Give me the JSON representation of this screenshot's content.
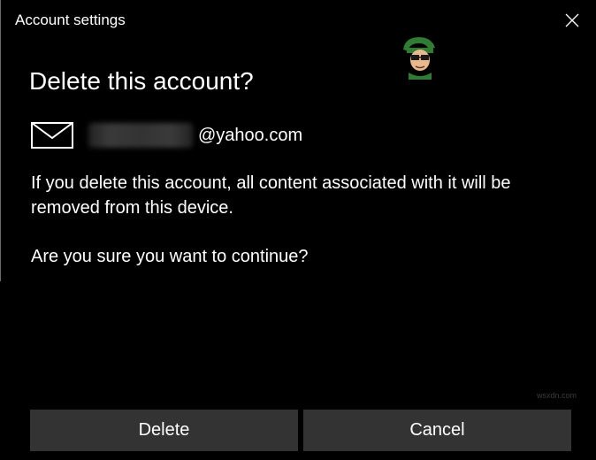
{
  "window": {
    "title": "Account settings",
    "close_icon": "close-icon"
  },
  "dialog": {
    "heading": "Delete this account?",
    "account": {
      "icon": "mail-icon",
      "email_suffix": "@yahoo.com"
    },
    "message": "If you delete this account, all content associated with it will be removed from this device.",
    "question": "Are you sure you want to continue?"
  },
  "buttons": {
    "delete_label": "Delete",
    "cancel_label": "Cancel"
  },
  "watermark": "wsxdn.com",
  "colors": {
    "background": "#000000",
    "text": "#ffffff",
    "button_bg": "#333333",
    "logo_green": "#2e7d32"
  }
}
